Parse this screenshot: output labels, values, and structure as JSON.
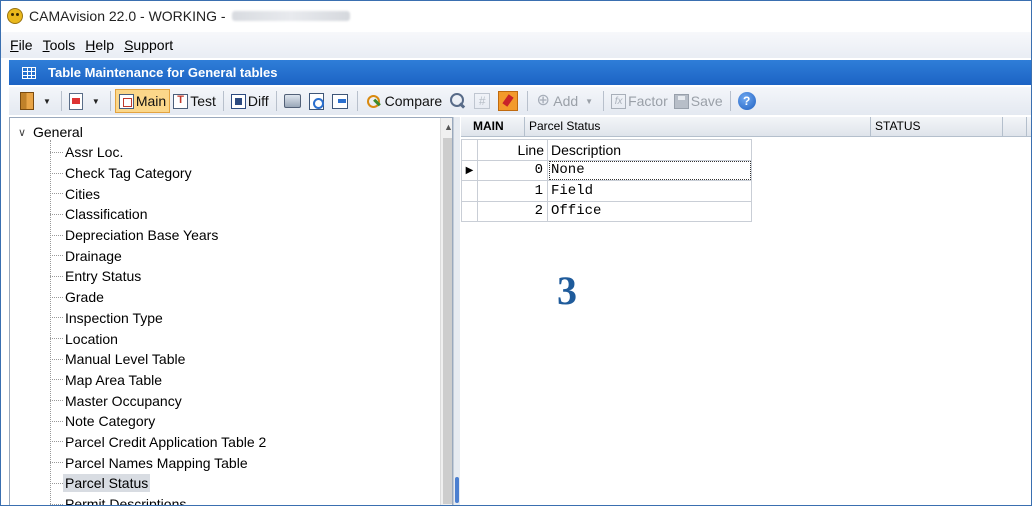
{
  "window": {
    "title": "CAMAvision 22.0 - WORKING -"
  },
  "menu": [
    {
      "accel": "F",
      "rest": "ile"
    },
    {
      "accel": "T",
      "rest": "ools"
    },
    {
      "accel": "H",
      "rest": "elp"
    },
    {
      "accel": "S",
      "rest": "upport"
    }
  ],
  "panel_header": {
    "title": "Table Maintenance for General tables"
  },
  "toolbar": {
    "main_label": "Main",
    "test_label": "Test",
    "diff_label": "Diff",
    "compare_label": "Compare",
    "hash_label": "#",
    "add_label": "Add",
    "factor_label": "Factor",
    "save_label": "Save",
    "help_label": "?",
    "active_tool": "Main"
  },
  "tree": {
    "root": "General",
    "items": [
      "Assr Loc.",
      "Check Tag Category",
      "Cities",
      "Classification",
      "Depreciation Base Years",
      "Drainage",
      "Entry Status",
      "Grade",
      "Inspection Type",
      "Location",
      "Manual Level Table",
      "Map Area Table",
      "Master Occupancy",
      "Note Category",
      "Parcel Credit Application Table 2",
      "Parcel Names Mapping Table",
      "Parcel Status",
      "Permit Descriptions"
    ],
    "selected": "Parcel Status"
  },
  "grid": {
    "main_label": "MAIN",
    "table_title": "Parcel Status",
    "table_code": "STATUS",
    "columns": {
      "line": "Line",
      "description": "Description"
    },
    "rows": [
      {
        "line": "0",
        "description": "None"
      },
      {
        "line": "1",
        "description": "Field"
      },
      {
        "line": "2",
        "description": "Office"
      }
    ]
  },
  "annotation": "3",
  "colors": {
    "header_blue": "#1c63c4",
    "active_tool": "#fbd78a",
    "annotation": "#1f5b9b"
  }
}
